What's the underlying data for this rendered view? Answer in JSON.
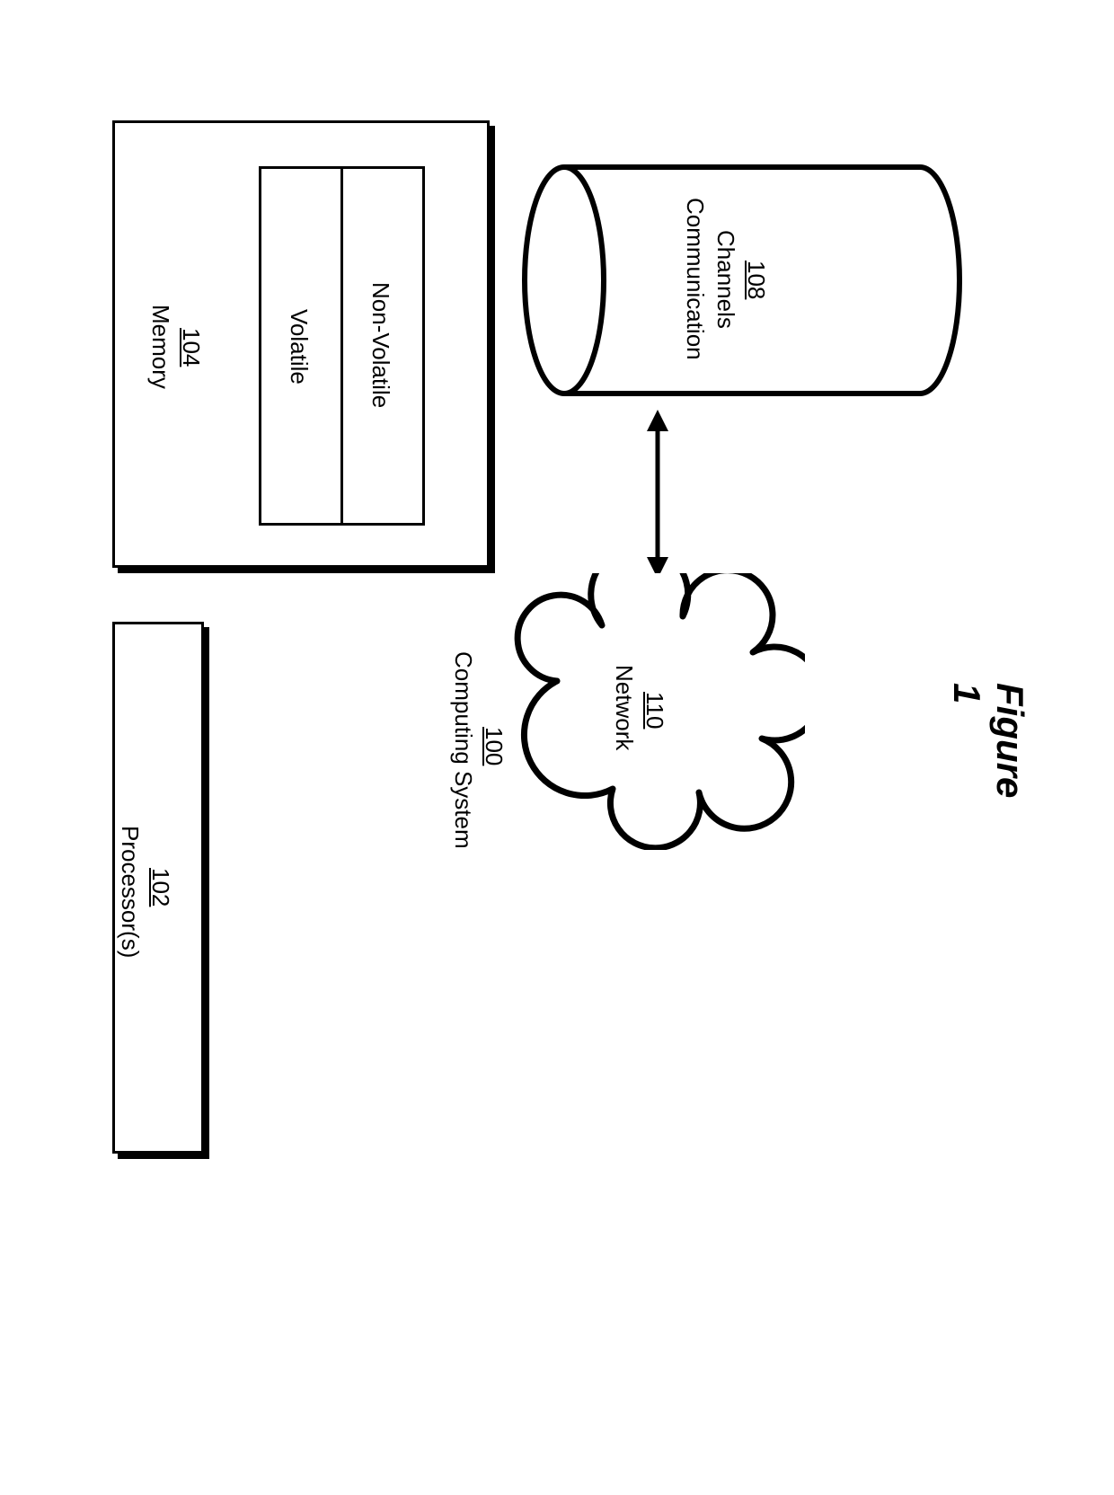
{
  "figure": {
    "caption": "Figure 1"
  },
  "system": {
    "title": "Computing System",
    "ref": "100"
  },
  "processors": {
    "title": "Processor(s)",
    "ref": "102"
  },
  "memory": {
    "title": "Memory",
    "ref": "104",
    "volatile": "Volatile",
    "nonvolatile": "Non-Volatile"
  },
  "channels": {
    "title": "Communication",
    "title2": "Channels",
    "ref": "108"
  },
  "network": {
    "title": "Network",
    "ref": "110"
  }
}
